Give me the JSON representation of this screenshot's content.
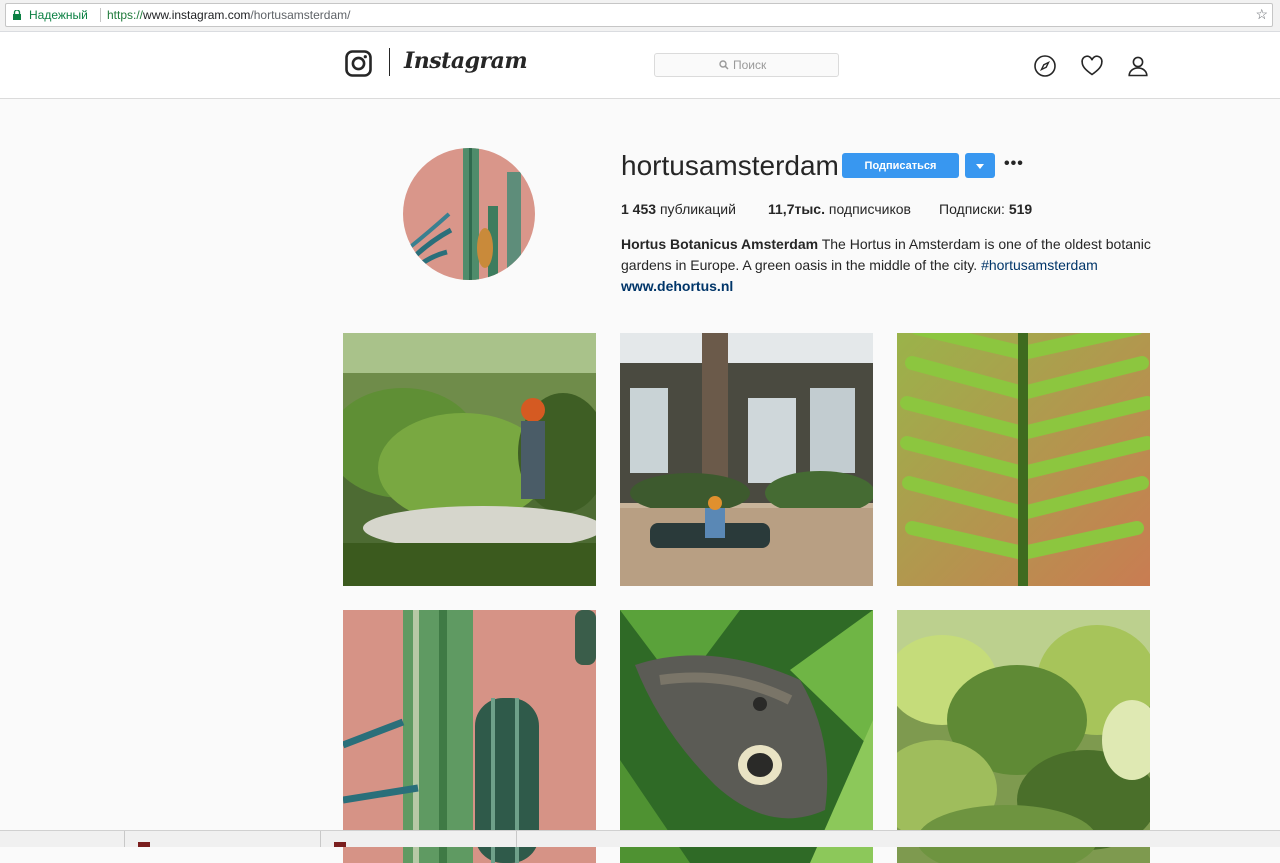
{
  "browser": {
    "secure_label": "Надежный",
    "url_scheme": "https://",
    "url_host": "www.instagram.com",
    "url_path": "/hortusamsterdam/"
  },
  "header": {
    "wordmark": "Instagram",
    "search_placeholder": "Поиск"
  },
  "profile": {
    "username": "hortusamsterdam",
    "follow_label": "Подписаться",
    "more_label": "•••",
    "stats": {
      "posts_count": "1 453",
      "posts_label": "публикаций",
      "followers_count": "11,7тыс.",
      "followers_label": "подписчиков",
      "following_label": "Подписки:",
      "following_count": "519"
    },
    "bio": {
      "name": "Hortus Botanicus Amsterdam",
      "text": "The Hortus in Amsterdam is one of the oldest botanic gardens in Europe. A green oasis in the middle of the city.",
      "hashtag": "#hortusamsterdam",
      "website": "www.dehortus.nl"
    }
  },
  "posts": [
    {
      "subject": "woman among giant rhubarb leaves"
    },
    {
      "subject": "man on bench in palm greenhouse"
    },
    {
      "subject": "fern leaf close-up"
    },
    {
      "subject": "cacti against pink wall"
    },
    {
      "subject": "owl butterfly on leaf"
    },
    {
      "subject": "tropical greenhouse foliage"
    }
  ],
  "colors": {
    "accent": "#3897f0",
    "link": "#003569",
    "secure": "#0b8043"
  }
}
